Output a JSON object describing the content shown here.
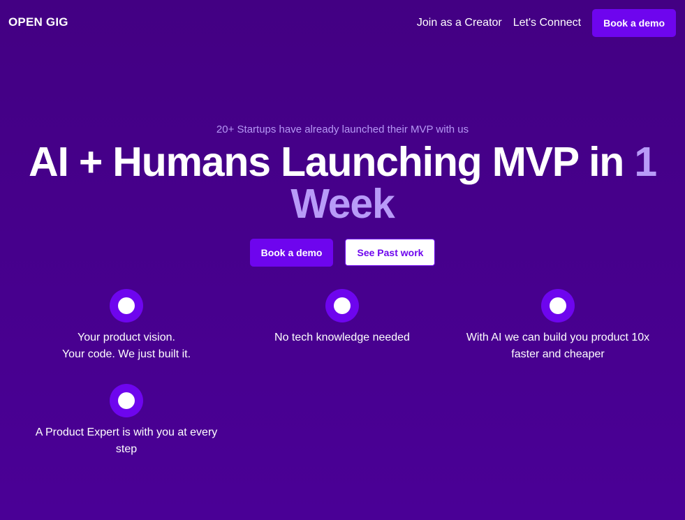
{
  "nav": {
    "logo": "OPEN GIG",
    "links": [
      "Join as a Creator",
      "Let's Connect"
    ],
    "cta": "Book a demo"
  },
  "hero": {
    "tagline": "20+ Startups have already launched their MVP with us",
    "headline_main": "AI + Humans Launching MVP in",
    "headline_accent": "1 Week",
    "primary_button": "Book a demo",
    "secondary_button": "See Past work"
  },
  "features": [
    {
      "line1": "Your product vision.",
      "line2": "Your code. We just built it."
    },
    {
      "line1": "No tech knowledge needed",
      "line2": ""
    },
    {
      "line1": "With AI we can build you product 10x",
      "line2": "faster and cheaper"
    },
    {
      "line1": "A Product Expert is with you at every",
      "line2": "step"
    }
  ],
  "colors": {
    "background": "#430083",
    "accent": "#6e05ee",
    "accent_light": "#b89bf8"
  }
}
